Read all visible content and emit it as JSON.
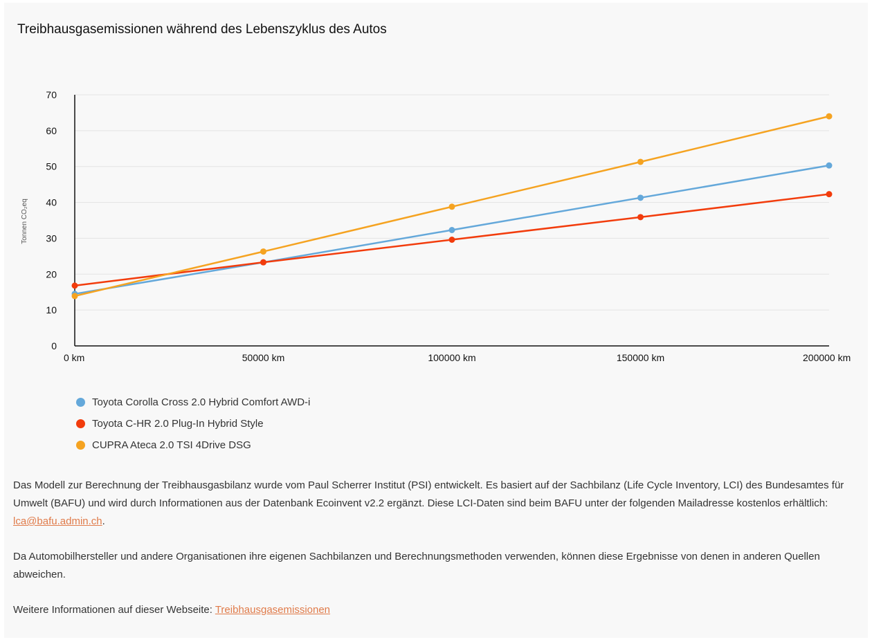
{
  "title": "Treibhausgasemissionen während des Lebenszyklus des Autos",
  "chart_data": {
    "type": "line",
    "x": [
      0,
      50000,
      100000,
      150000,
      200000
    ],
    "x_tick_labels": [
      "0 km",
      "50000 km",
      "100000 km",
      "150000 km",
      "200000 km"
    ],
    "xlim": [
      0,
      200000
    ],
    "ylim": [
      0,
      70
    ],
    "y_ticks": [
      0,
      10,
      20,
      30,
      40,
      50,
      60,
      70
    ],
    "ylabel": "Tonnen CO₂eq",
    "xlabel": "",
    "grid": true,
    "legend_position": "bottom-left",
    "series": [
      {
        "name": "Toyota Corolla Cross 2.0 Hybrid Comfort AWD-i",
        "color": "#64a8da",
        "values": [
          14.5,
          23.3,
          32.3,
          41.3,
          50.3
        ]
      },
      {
        "name": "Toyota C-HR 2.0 Plug-In Hybrid Style",
        "color": "#f23c0c",
        "values": [
          16.8,
          23.3,
          29.6,
          35.9,
          42.3
        ]
      },
      {
        "name": "CUPRA Ateca 2.0 TSI 4Drive DSG",
        "color": "#f5a321",
        "values": [
          13.9,
          26.3,
          38.8,
          51.3,
          64.0
        ]
      }
    ]
  },
  "text": {
    "p1_before": "Das Modell zur Berechnung der Treibhausgasbilanz wurde vom Paul Scherrer Institut (PSI) entwickelt. Es basiert auf der Sachbilanz (Life Cycle Inventory, LCI) des Bundesamtes für Umwelt (BAFU) und wird durch Informationen aus der Datenbank Ecoinvent v2.2 ergänzt. Diese LCI-Daten sind beim BAFU unter der folgenden Mailadresse kostenlos erhältlich: ",
    "p1_link": "lca@bafu.admin.ch",
    "p1_after": ".",
    "p2": "Da Automobilhersteller und andere Organisationen ihre eigenen Sachbilanzen und Berechnungsmethoden verwenden, können diese Ergebnisse von denen in anderen Quellen abweichen.",
    "p3_before": "Weitere Informationen auf dieser Webseite: ",
    "p3_link": "Treibhausgasemissionen"
  }
}
